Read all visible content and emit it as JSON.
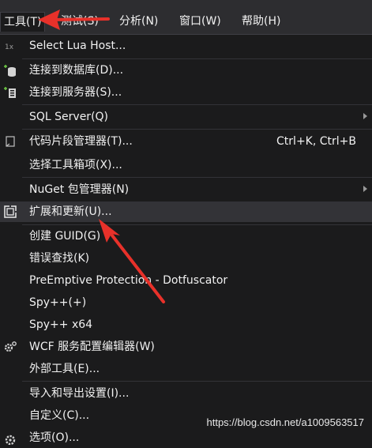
{
  "menubar": {
    "items": [
      "工具(T)",
      "测试(S)",
      "分析(N)",
      "窗口(W)",
      "帮助(H)"
    ]
  },
  "menu": {
    "items": [
      {
        "label": "Select Lua Host...",
        "icon": "lua-host-icon"
      },
      {
        "label": "连接到数据库(D)...",
        "icon": "connect-database-icon"
      },
      {
        "label": "连接到服务器(S)...",
        "icon": "connect-server-icon"
      },
      {
        "label": "SQL Server(Q)",
        "submenu": true
      },
      {
        "label": "代码片段管理器(T)...",
        "shortcut": "Ctrl+K, Ctrl+B",
        "icon": "code-snippet-icon"
      },
      {
        "label": "选择工具箱项(X)..."
      },
      {
        "label": "NuGet 包管理器(N)",
        "submenu": true
      },
      {
        "label": "扩展和更新(U)...",
        "icon": "extensions-icon",
        "highlighted": true
      },
      {
        "label": "创建 GUID(G)"
      },
      {
        "label": "错误查找(K)"
      },
      {
        "label": "PreEmptive Protection - Dotfuscator"
      },
      {
        "label": "Spy++(+)"
      },
      {
        "label": "Spy++ x64"
      },
      {
        "label": "WCF 服务配置编辑器(W)",
        "icon": "wcf-config-icon"
      },
      {
        "label": "外部工具(E)..."
      },
      {
        "label": "导入和导出设置(I)..."
      },
      {
        "label": "自定义(C)..."
      },
      {
        "label": "选项(O)...",
        "icon": "options-gear-icon"
      }
    ]
  },
  "watermark": "https://blog.csdn.net/a1009563517",
  "colors": {
    "annotation_arrow": "#e8312a",
    "background": "#1b1b1c",
    "hover": "#333337"
  }
}
